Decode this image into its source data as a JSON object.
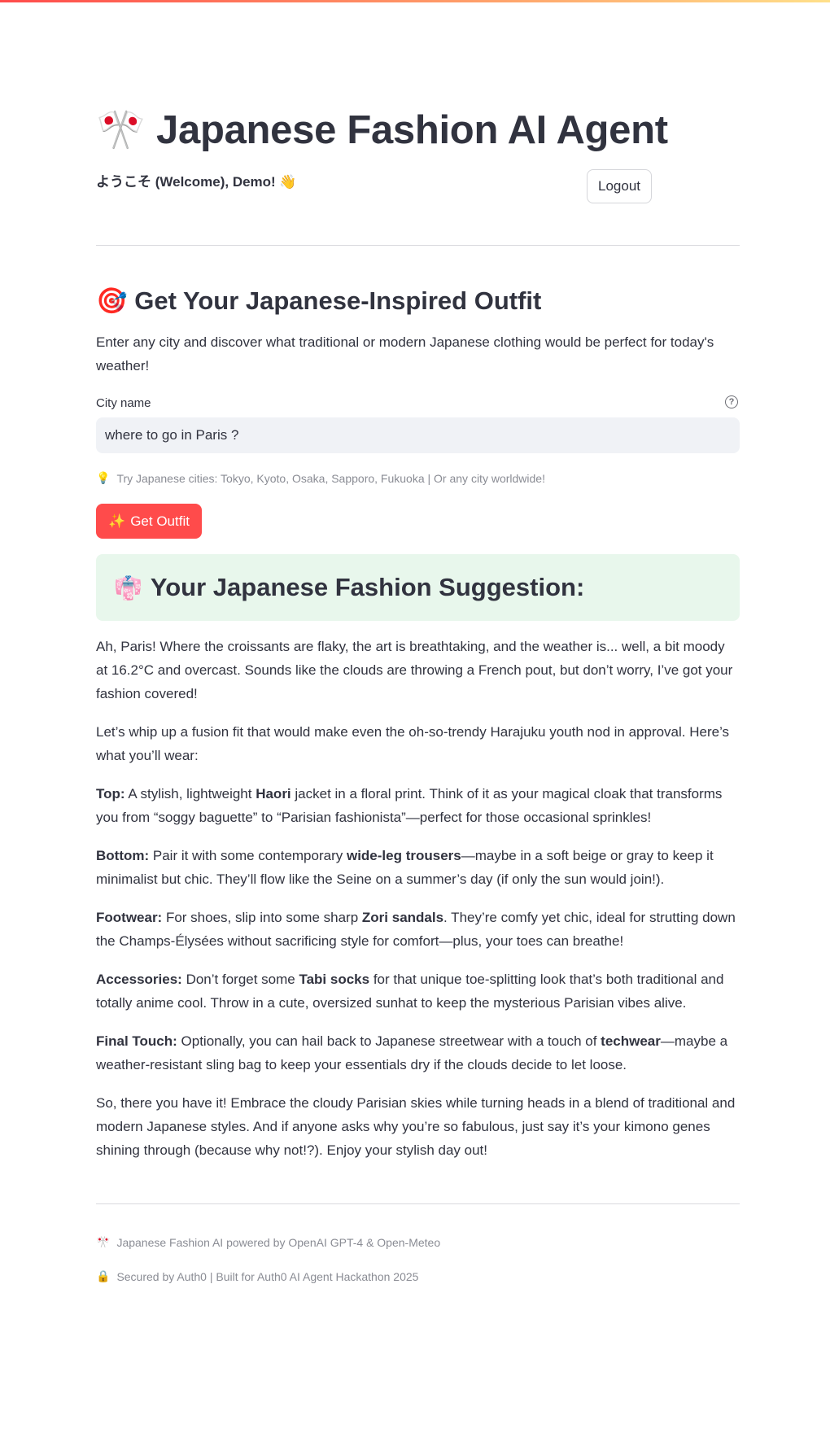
{
  "header": {
    "title_emoji": "🎌",
    "title": "Japanese Fashion AI Agent",
    "welcome": "ようこそ (Welcome), Demo! 👋",
    "logout_label": "Logout"
  },
  "section": {
    "emoji": "🎯",
    "title": "Get Your Japanese-Inspired Outfit",
    "intro": "Enter any city and discover what traditional or modern Japanese clothing would be perfect for today's weather!"
  },
  "form": {
    "label": "City name",
    "help_icon": "?",
    "value": "where to go in Paris ?",
    "hint_emoji": "💡",
    "hint": "Try Japanese cities: Tokyo, Kyoto, Osaka, Sapporo, Fukuoka | Or any city worldwide!",
    "button_emoji": "✨",
    "button_label": "Get Outfit"
  },
  "suggestion": {
    "emoji": "👘",
    "title": "Your Japanese Fashion Suggestion:",
    "paragraphs": [
      "Ah, Paris! Where the croissants are flaky, the art is breathtaking, and the weather is... well, a bit moody at 16.2°C and overcast. Sounds like the clouds are throwing a French pout, but don’t worry, I’ve got your fashion covered!",
      "Let’s whip up a fusion fit that would make even the oh-so-trendy Harajuku youth nod in approval. Here’s what you’ll wear:"
    ],
    "top": {
      "label": "Top:",
      "pre": " A stylish, lightweight ",
      "bold": "Haori",
      "post": " jacket in a floral print. Think of it as your magical cloak that transforms you from “soggy baguette” to “Parisian fashionista”—perfect for those occasional sprinkles!"
    },
    "bottom": {
      "label": "Bottom:",
      "pre": " Pair it with some contemporary ",
      "bold": "wide-leg trousers",
      "post": "—maybe in a soft beige or gray to keep it minimalist but chic. They’ll flow like the Seine on a summer’s day (if only the sun would join!)."
    },
    "footwear": {
      "label": "Footwear:",
      "pre": " For shoes, slip into some sharp ",
      "bold": "Zori sandals",
      "post": ". They’re comfy yet chic, ideal for strutting down the Champs-Élysées without sacrificing style for comfort—plus, your toes can breathe!"
    },
    "accessories": {
      "label": "Accessories:",
      "pre": " Don’t forget some ",
      "bold": "Tabi socks",
      "post": " for that unique toe-splitting look that’s both traditional and totally anime cool. Throw in a cute, oversized sunhat to keep the mysterious Parisian vibes alive."
    },
    "final": {
      "label": "Final Touch:",
      "pre": " Optionally, you can hail back to Japanese streetwear with a touch of ",
      "bold": "techwear",
      "post": "—maybe a weather-resistant sling bag to keep your essentials dry if the clouds decide to let loose."
    },
    "closing": "So, there you have it! Embrace the cloudy Parisian skies while turning heads in a blend of traditional and modern Japanese styles. And if anyone asks why you’re so fabulous, just say it’s your kimono genes shining through (because why not!?). Enjoy your stylish day out!"
  },
  "footer": {
    "line1_emoji": "🎌",
    "line1": "Japanese Fashion AI powered by OpenAI GPT-4 & Open-Meteo",
    "line2_emoji": "🔒",
    "line2": "Secured by Auth0 | Built for Auth0 AI Agent Hackathon 2025"
  },
  "colors": {
    "primary_button": "#ff4b4b",
    "input_bg": "#f0f2f6",
    "success_bg": "#e8f7ec",
    "text": "#31333f"
  }
}
